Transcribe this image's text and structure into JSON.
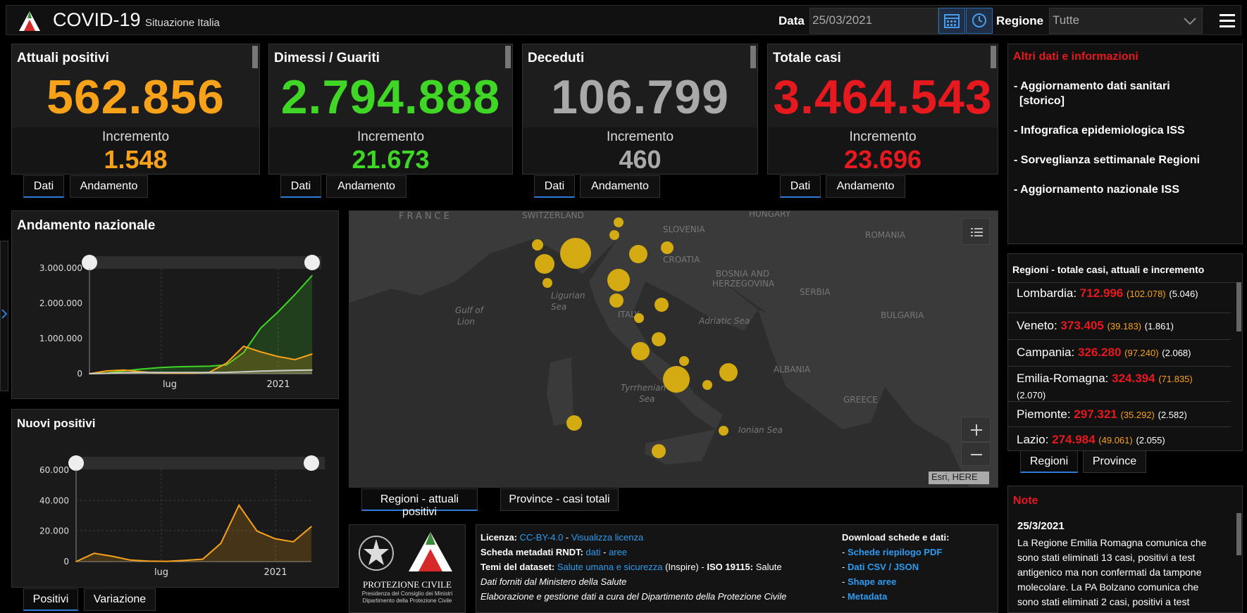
{
  "header": {
    "title": "COVID-19",
    "subtitle": "Situazione Italia",
    "date_label": "Data",
    "date_value": "25/03/2021",
    "region_label": "Regione",
    "region_value": "Tutte"
  },
  "cards": [
    {
      "title": "Attuali positivi",
      "value": "562.856",
      "inc_label": "Incremento",
      "inc": "1.548",
      "color": "#f8a21a",
      "tab1": "Dati",
      "tab2": "Andamento"
    },
    {
      "title": "Dimessi / Guariti",
      "value": "2.794.888",
      "inc_label": "Incremento",
      "inc": "21.673",
      "color": "#3fd626",
      "tab1": "Dati",
      "tab2": "Andamento"
    },
    {
      "title": "Deceduti",
      "value": "106.799",
      "inc_label": "Incremento",
      "inc": "460",
      "color": "#a9a9a9",
      "tab1": "Dati",
      "tab2": "Andamento"
    },
    {
      "title": "Totale casi",
      "value": "3.464.543",
      "inc_label": "Incremento",
      "inc": "23.696",
      "color": "#e6191f",
      "tab1": "Dati",
      "tab2": "Andamento"
    }
  ],
  "andamento": {
    "title": "Andamento nazionale",
    "yticks": [
      "3.000.000",
      "2.000.000",
      "1.000.000",
      "0"
    ],
    "xticks": [
      "lug",
      "2021"
    ]
  },
  "nuovi": {
    "title": "Nuovi positivi",
    "yticks": [
      "60.000",
      "40.000",
      "20.000",
      "0"
    ],
    "xticks": [
      "lug",
      "2021"
    ],
    "tab1": "Positivi",
    "tab2": "Variazione"
  },
  "map": {
    "labels": {
      "france": "FRANCE",
      "switzerland": "SWITZERLAND",
      "hungary": "HUNGARY",
      "slovenia": "SLOVENIA",
      "romania": "ROMANIA",
      "croatia": "CROATIA",
      "bosnia1": "BOSNIA AND",
      "bosnia2": "HERZEGOVINA",
      "serbia": "SERBIA",
      "bulgaria": "BULGARIA",
      "albania": "ALBANIA",
      "greece": "GREECE",
      "italy": "ITALY",
      "ligurian1": "Ligurian",
      "ligurian2": "Sea",
      "lion1": "Gulf of",
      "lion2": "Lion",
      "adriatic": "Adriatic Sea",
      "tyrrhenian1": "Tyrrhenian",
      "tyrrhenian2": "Sea",
      "ionian": "Ionian Sea"
    },
    "attribution": "Esri, HERE",
    "tab1": "Regioni - attuali positivi",
    "tab2": "Province - casi totali"
  },
  "info": {
    "title": "Altri dati e informazioni",
    "links": [
      "- Aggiornamento dati sanitari",
      "[storico]",
      "- Infografica epidemiologica ISS",
      "- Sorveglianza settimanale Regioni",
      "- Aggiornamento nazionale ISS"
    ]
  },
  "regions": {
    "title": "Regioni - totale casi, attuali e incremento",
    "rows": [
      {
        "name": "Lombardia:",
        "total": "712.996",
        "current": "(102.078)",
        "inc": "(5.046)"
      },
      {
        "name": "Veneto:",
        "total": "373.405",
        "current": "(39.183)",
        "inc": "(1.861)"
      },
      {
        "name": "Campania:",
        "total": "326.280",
        "current": "(97.240)",
        "inc": "(2.068)"
      },
      {
        "name": "Emilia-Romagna:",
        "total": "324.394",
        "current": "(71.835)",
        "inc": "(2.070)"
      },
      {
        "name": "Piemonte:",
        "total": "297.321",
        "current": "(35.292)",
        "inc": "(2.582)"
      },
      {
        "name": "Lazio:",
        "total": "274.984",
        "current": "(49.061)",
        "inc": "(2.055)"
      }
    ],
    "tab1": "Regioni",
    "tab2": "Province"
  },
  "note": {
    "title": "Note",
    "date": "25/3/2021",
    "lines": [
      "La Regione Emilia Romagna comunica che",
      "sono stati eliminati 13 casi, positivi a test",
      "antigenico ma non confermati da tampone",
      "molecolare. La PA Bolzano comunica che",
      "sono stati eliminati 2 casi, positivi a test"
    ]
  },
  "footer": {
    "logo_text1": "PROTEZIONE CIVILE",
    "logo_text2": "Presidenza del Consiglio dei Ministri",
    "logo_text3": "Dipartimento della Protezione Civile",
    "licenza_label": "Licenza:",
    "licenza_link": "CC-BY-4.0",
    "licenza_sep": " - ",
    "licenza_view": "Visualizza licenza",
    "scheda_label": "Scheda metadati RNDT:",
    "scheda_dati": "dati",
    "scheda_sep": " - ",
    "scheda_aree": "aree",
    "temi_label": "Temi del dataset:",
    "temi_link": "Salute umana e sicurezza",
    "temi_inspire": "(Inspire) -",
    "iso_label": "ISO 19115:",
    "iso_value": "Salute",
    "line4": "Dati forniti dal Ministero della Salute",
    "line5": "Elaborazione e gestione dati a cura del Dipartimento della Protezione Civile",
    "download_title": "Download schede e dati:",
    "downloads": [
      "Schede riepilogo PDF",
      "Dati CSV / JSON",
      "Shape aree",
      "Metadata"
    ]
  },
  "chart_data": [
    {
      "type": "area",
      "title": "Andamento nazionale",
      "x": [
        "2020-02",
        "2020-03",
        "2020-04",
        "2020-05",
        "2020-06",
        "2020-07",
        "2020-08",
        "2020-09",
        "2020-10",
        "2020-11",
        "2020-12",
        "2021-01",
        "2021-02",
        "2021-03"
      ],
      "series": [
        {
          "values": [
            0,
            20000,
            80000,
            130000,
            170000,
            195000,
            205000,
            215000,
            250000,
            600000,
            1300000,
            1750000,
            2250000,
            2790000
          ],
          "color": "#3fd626"
        },
        {
          "values": [
            0,
            80000,
            105000,
            55000,
            20000,
            13000,
            15000,
            40000,
            300000,
            780000,
            620000,
            490000,
            400000,
            560000
          ],
          "color": "#f8a21a"
        },
        {
          "values": [
            0,
            10000,
            28000,
            33000,
            34500,
            35100,
            35400,
            35900,
            38000,
            55000,
            73000,
            88000,
            98000,
            106800
          ],
          "color": "#cccccc"
        }
      ],
      "ylim": [
        0,
        3000000
      ]
    },
    {
      "type": "area",
      "title": "Nuovi positivi",
      "x": [
        "2020-02",
        "2020-03",
        "2020-04",
        "2020-05",
        "2020-06",
        "2020-07",
        "2020-08",
        "2020-09",
        "2020-10",
        "2020-11",
        "2020-12",
        "2021-01",
        "2021-02",
        "2021-03"
      ],
      "series": [
        {
          "values": [
            0,
            5500,
            3500,
            1000,
            300,
            200,
            800,
            1600,
            12000,
            37000,
            20000,
            15000,
            13000,
            23000
          ],
          "color": "#f8a21a"
        }
      ],
      "ylim": [
        0,
        60000
      ]
    }
  ]
}
